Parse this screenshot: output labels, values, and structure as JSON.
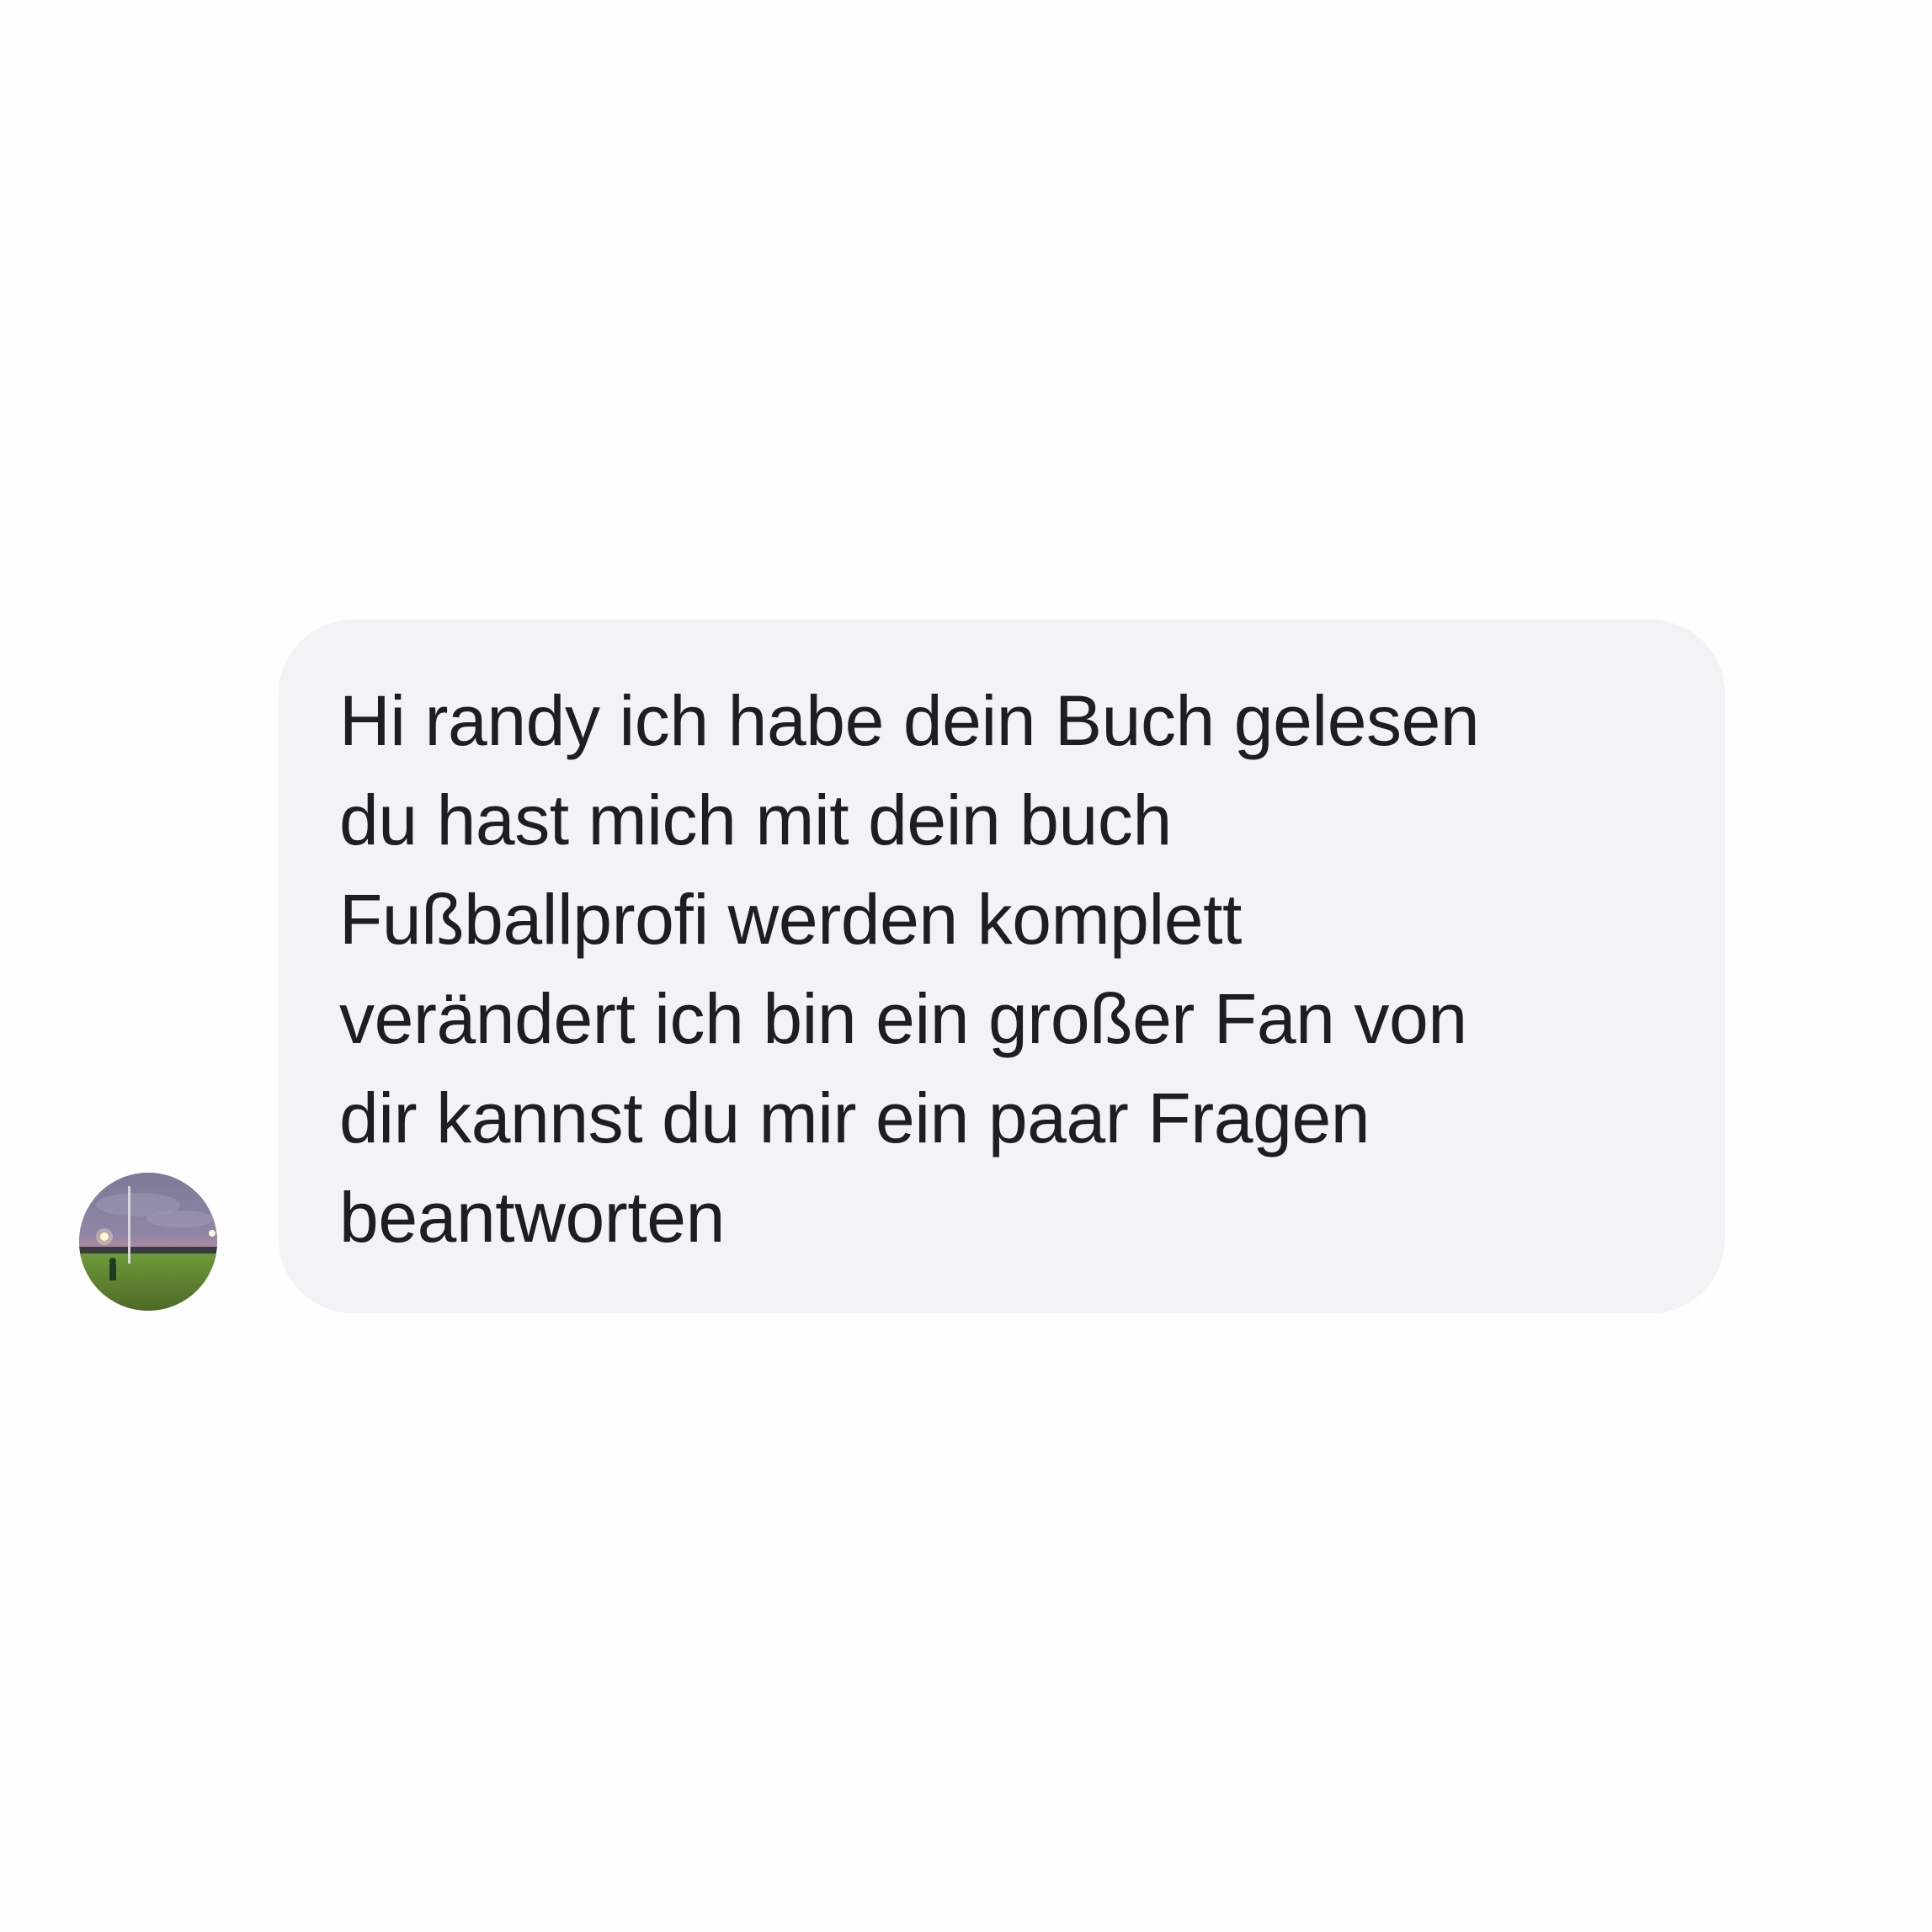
{
  "conversation": {
    "message": {
      "text": "Hi randy ich habe dein Buch gelesen\ndu hast mich mit dein buch\nFußballprofi werden komplett\nverändert ich bin ein großer Fan von\ndir kannst du mir ein paar Fragen\nbeantworten",
      "bubble_color": "#f2f3f5",
      "text_color": "#1c1e21"
    },
    "sender": {
      "avatar_icon": "avatar-photo-football-field-at-dusk"
    }
  }
}
